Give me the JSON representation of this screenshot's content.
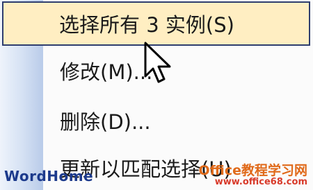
{
  "menu": {
    "items": [
      {
        "label": "选择所有 3 实例(S)",
        "highlighted": true
      },
      {
        "label": "修改(M)..."
      },
      {
        "label": "删除(D)..."
      },
      {
        "label": "更新以匹配选择(U)"
      }
    ]
  },
  "watermarks": {
    "left": "WordHome",
    "right_title": "Office教程学习网",
    "right_url": "www.office68.com"
  },
  "colors": {
    "highlight_bg": "#ffeec2",
    "highlight_border": "#2e3d6e",
    "gutter": "#c9d8ef"
  }
}
